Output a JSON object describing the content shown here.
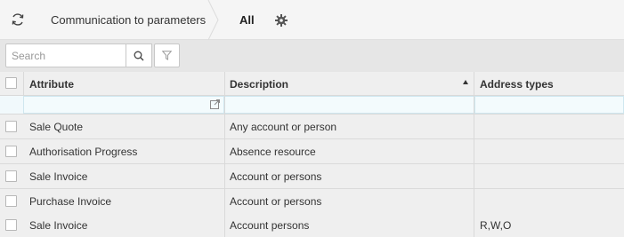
{
  "header": {
    "breadcrumb_title": "Communication to parameters",
    "tab_all": "All"
  },
  "search": {
    "placeholder": "Search",
    "value": ""
  },
  "table": {
    "columns": [
      "Attribute",
      "Description",
      "Address types"
    ],
    "sort": {
      "column": "Description",
      "direction": "ascending"
    },
    "rows": [
      {
        "attribute": "Sale Quote",
        "description": "Any account or person",
        "address_types": ""
      },
      {
        "attribute": "Authorisation Progress",
        "description": "Absence resource",
        "address_types": ""
      },
      {
        "attribute": "Sale Invoice",
        "description": "Account or persons",
        "address_types": ""
      },
      {
        "attribute": "Purchase Invoice",
        "description": "Account or persons",
        "address_types": ""
      },
      {
        "attribute": "Sale Invoice",
        "description": "Account persons",
        "address_types": "R,W,O"
      }
    ]
  },
  "colors": {
    "topbar_bg": "#f5f5f5",
    "toolbar_bg": "#e6e6e6",
    "grid_bg": "#efefef",
    "filter_row_bg": "#f1f9fc"
  }
}
